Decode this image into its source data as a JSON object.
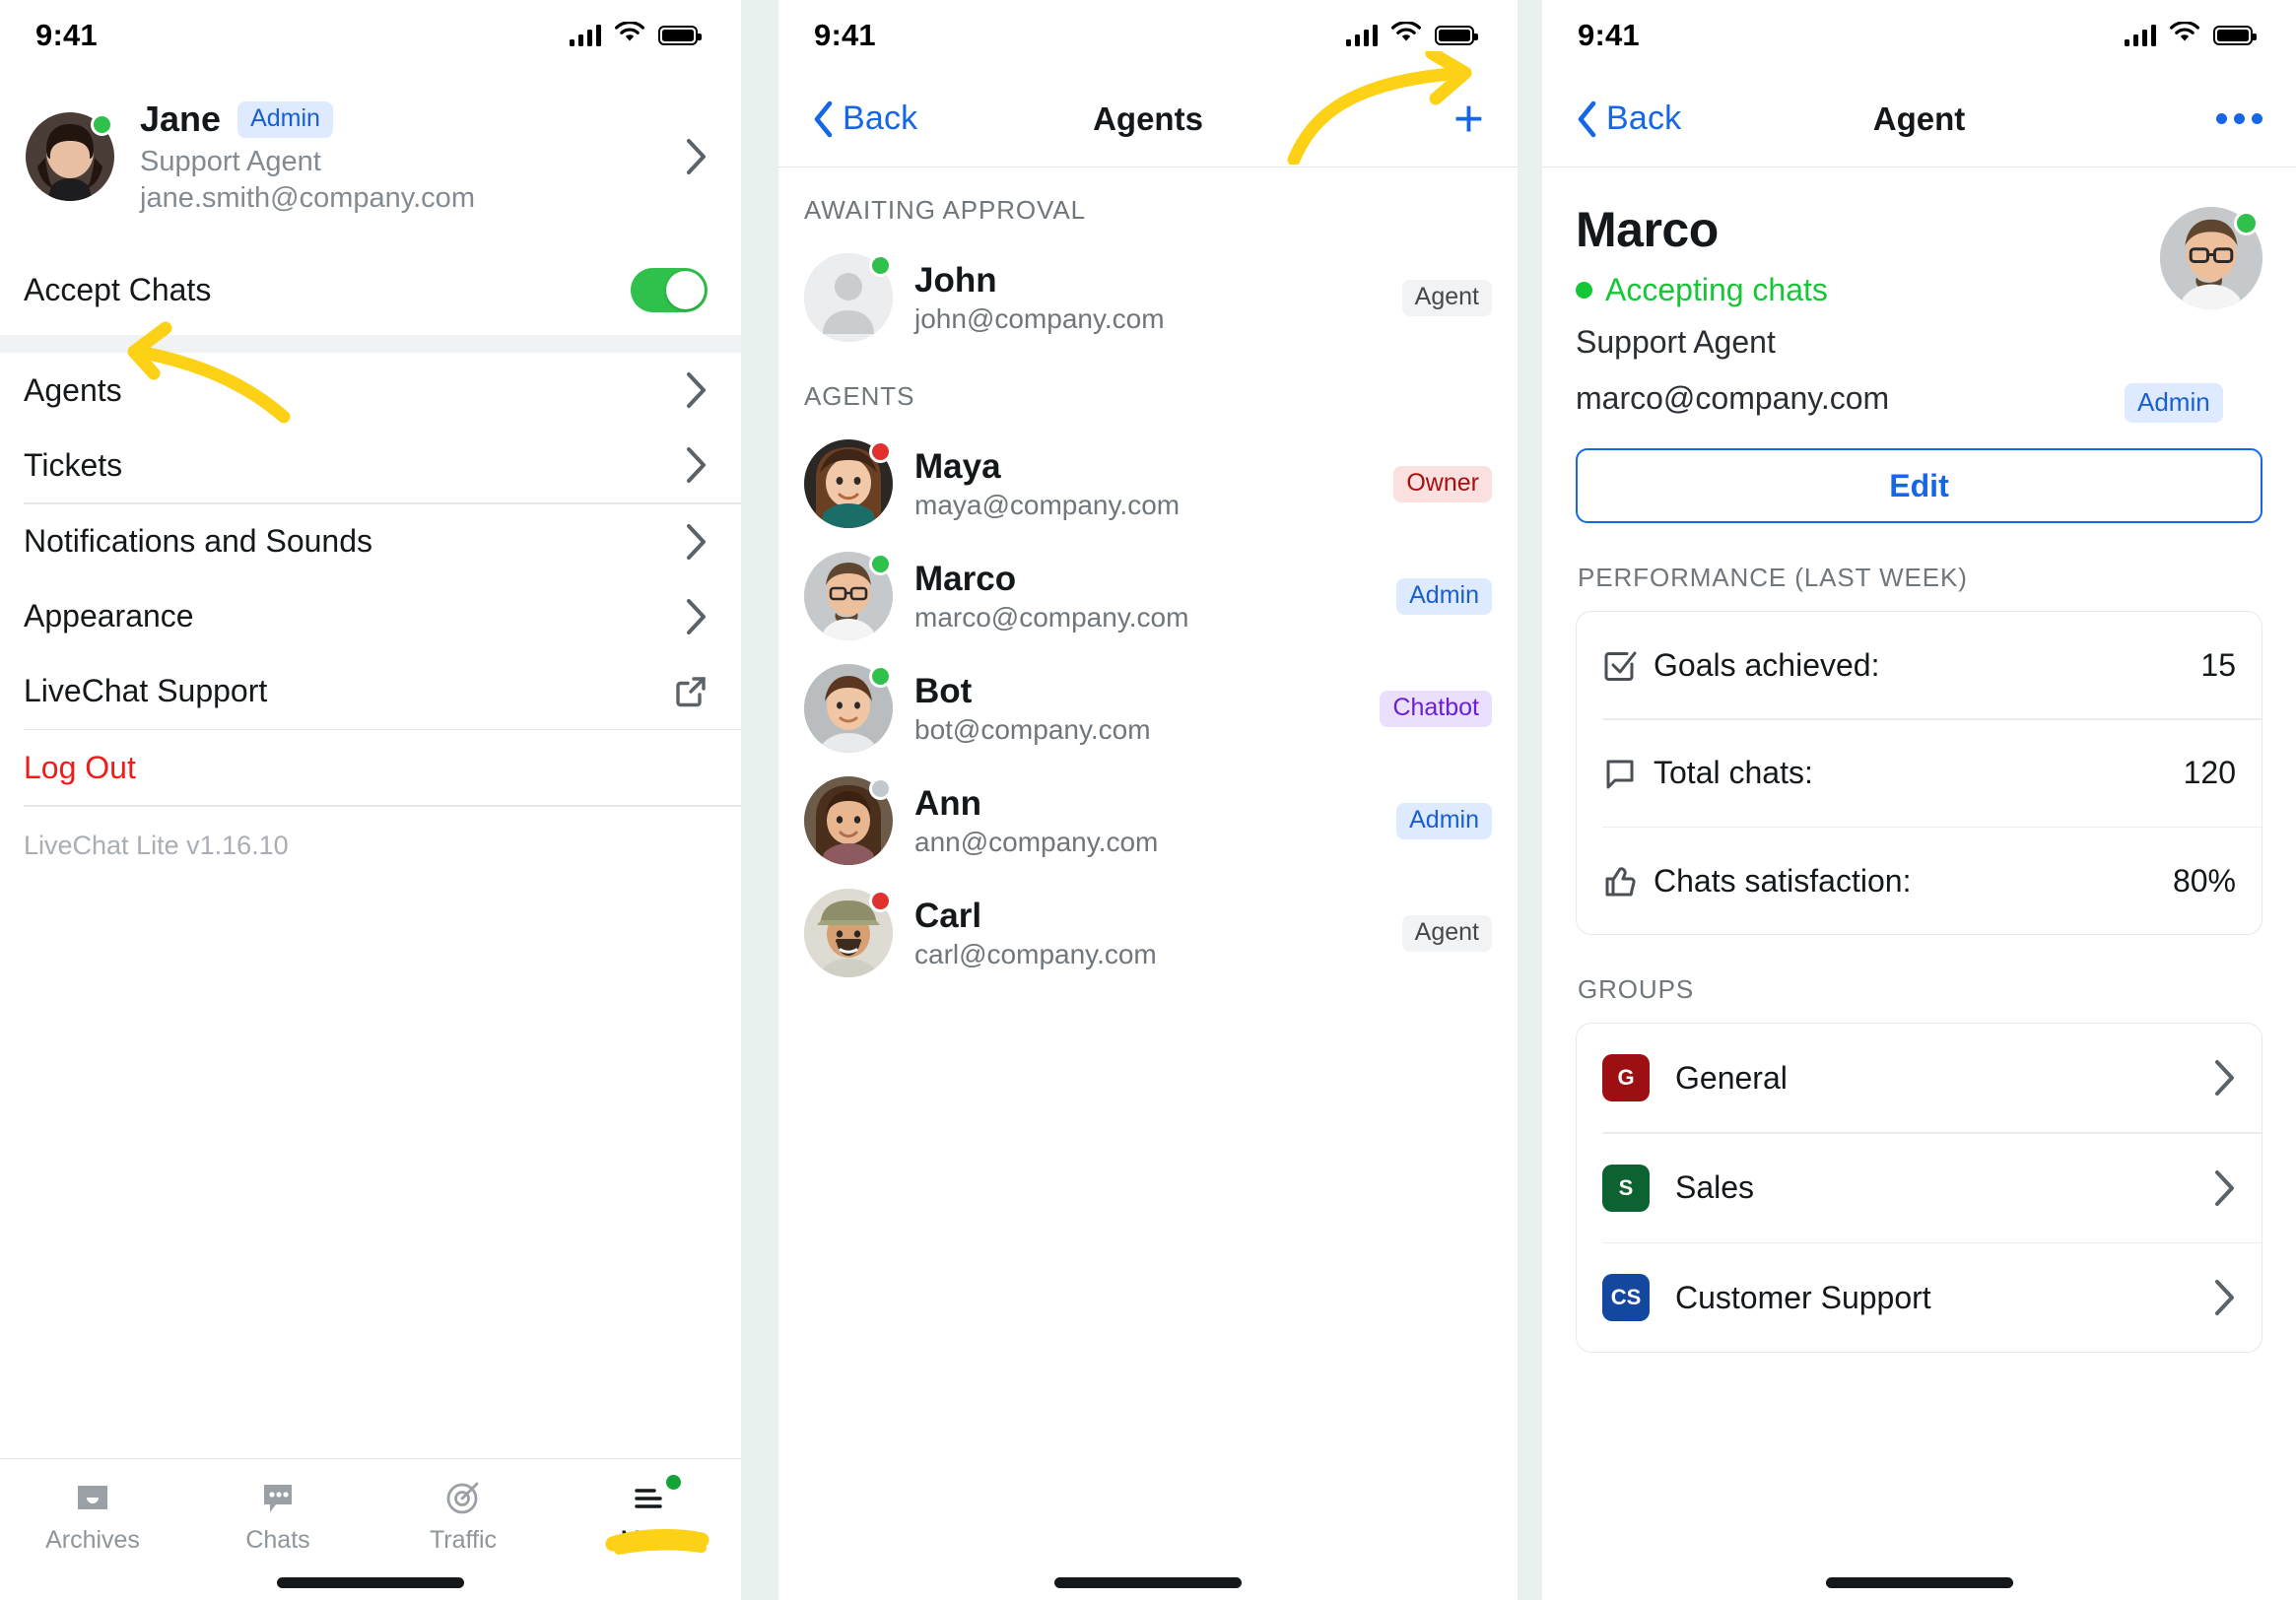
{
  "status_bar": {
    "time": "9:41"
  },
  "panel_more": {
    "profile": {
      "name": "Jane",
      "badge": "Admin",
      "role": "Support Agent",
      "email": "jane.smith@company.com",
      "presence": "online"
    },
    "accept_chats": {
      "label": "Accept Chats",
      "value": "on"
    },
    "menu_group_1": [
      {
        "label": "Agents",
        "accessory": "chevron"
      },
      {
        "label": "Tickets",
        "accessory": "chevron"
      }
    ],
    "menu_group_2": [
      {
        "label": "Notifications and Sounds",
        "accessory": "chevron"
      },
      {
        "label": "Appearance",
        "accessory": "chevron"
      },
      {
        "label": "LiveChat Support",
        "accessory": "external-link"
      }
    ],
    "logout": {
      "label": "Log Out"
    },
    "version": "LiveChat Lite v1.16.10",
    "tabs": [
      {
        "label": "Archives",
        "icon": "archive-icon",
        "active": false,
        "notif": false
      },
      {
        "label": "Chats",
        "icon": "chat-bubble-icon",
        "active": false,
        "notif": false
      },
      {
        "label": "Traffic",
        "icon": "target-icon",
        "active": false,
        "notif": false
      },
      {
        "label": "More",
        "icon": "hamburger-icon",
        "active": true,
        "notif": true
      }
    ]
  },
  "panel_agents": {
    "nav": {
      "back": "Back",
      "title": "Agents",
      "add": "+"
    },
    "sections": [
      {
        "title": "AWAITING APPROVAL",
        "rows": [
          {
            "name": "John",
            "email": "john@company.com",
            "badge": "Agent",
            "badge_kind": "agent",
            "presence": "online",
            "avatar": "placeholder"
          }
        ]
      },
      {
        "title": "AGENTS",
        "rows": [
          {
            "name": "Maya",
            "email": "maya@company.com",
            "badge": "Owner",
            "badge_kind": "owner",
            "presence": "busy",
            "avatar": "photo-child"
          },
          {
            "name": "Marco",
            "email": "marco@company.com",
            "badge": "Admin",
            "badge_kind": "admin",
            "presence": "online",
            "avatar": "photo-marco"
          },
          {
            "name": "Bot",
            "email": "bot@company.com",
            "badge": "Chatbot",
            "badge_kind": "chatbot",
            "presence": "online",
            "avatar": "photo-bot"
          },
          {
            "name": "Ann",
            "email": "ann@company.com",
            "badge": "Admin",
            "badge_kind": "admin",
            "presence": "offline",
            "avatar": "photo-ann"
          },
          {
            "name": "Carl",
            "email": "carl@company.com",
            "badge": "Agent",
            "badge_kind": "agent",
            "presence": "busy",
            "avatar": "photo-carl"
          }
        ]
      }
    ]
  },
  "panel_agent": {
    "nav": {
      "back": "Back",
      "title": "Agent",
      "menu": "•••"
    },
    "detail": {
      "name": "Marco",
      "status": "Accepting chats",
      "role": "Support Agent",
      "email": "marco@company.com",
      "badge": "Admin",
      "presence": "online"
    },
    "edit_button": "Edit",
    "performance": {
      "title": "PERFORMANCE (LAST WEEK)",
      "rows": [
        {
          "icon": "checkbox-icon",
          "label": "Goals achieved:",
          "value": "15"
        },
        {
          "icon": "chat-bubble-icon",
          "label": "Total chats:",
          "value": "120"
        },
        {
          "icon": "thumbs-up-icon",
          "label": "Chats satisfaction:",
          "value": "80%"
        }
      ]
    },
    "groups": {
      "title": "GROUPS",
      "rows": [
        {
          "initials": "G",
          "label": "General",
          "color": "#9c0f12"
        },
        {
          "initials": "S",
          "label": "Sales",
          "color": "#0d6232"
        },
        {
          "initials": "CS",
          "label": "Customer Support",
          "color": "#14479e"
        }
      ]
    }
  },
  "annotations": [
    {
      "name": "arrow-to-agents",
      "kind": "curved-arrow",
      "color": "#fcd116"
    },
    {
      "name": "arrow-to-add-agent",
      "kind": "curved-arrow",
      "color": "#fcd116"
    },
    {
      "name": "highlight-more-tab",
      "kind": "marker-underline",
      "color": "#fcd116"
    }
  ],
  "colors": {
    "accent_blue": "#1667e8",
    "online_green": "#2fc14b",
    "busy_red": "#e03131",
    "offline_gray": "#c3c8cc",
    "danger_red": "#f01c1c",
    "annotation_yellow": "#fcd116",
    "page_background": "#e8f1ee"
  }
}
